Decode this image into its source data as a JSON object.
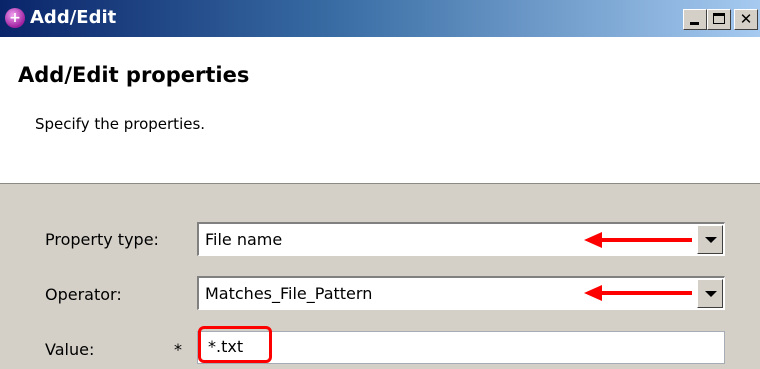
{
  "window": {
    "title": "Add/Edit",
    "controls": [
      "minimize",
      "maximize",
      "close"
    ]
  },
  "banner": {
    "title": "Add/Edit properties",
    "description": "Specify the properties."
  },
  "form": {
    "property_type": {
      "label": "Property type:",
      "value": "File name"
    },
    "operator": {
      "label": "Operator:",
      "value": "Matches_File_Pattern"
    },
    "value": {
      "label": "Value:",
      "required_marker": "*",
      "value": "*.txt"
    }
  },
  "annotations": {
    "arrow_color": "#ff0000",
    "highlight_color": "#ff0000"
  }
}
